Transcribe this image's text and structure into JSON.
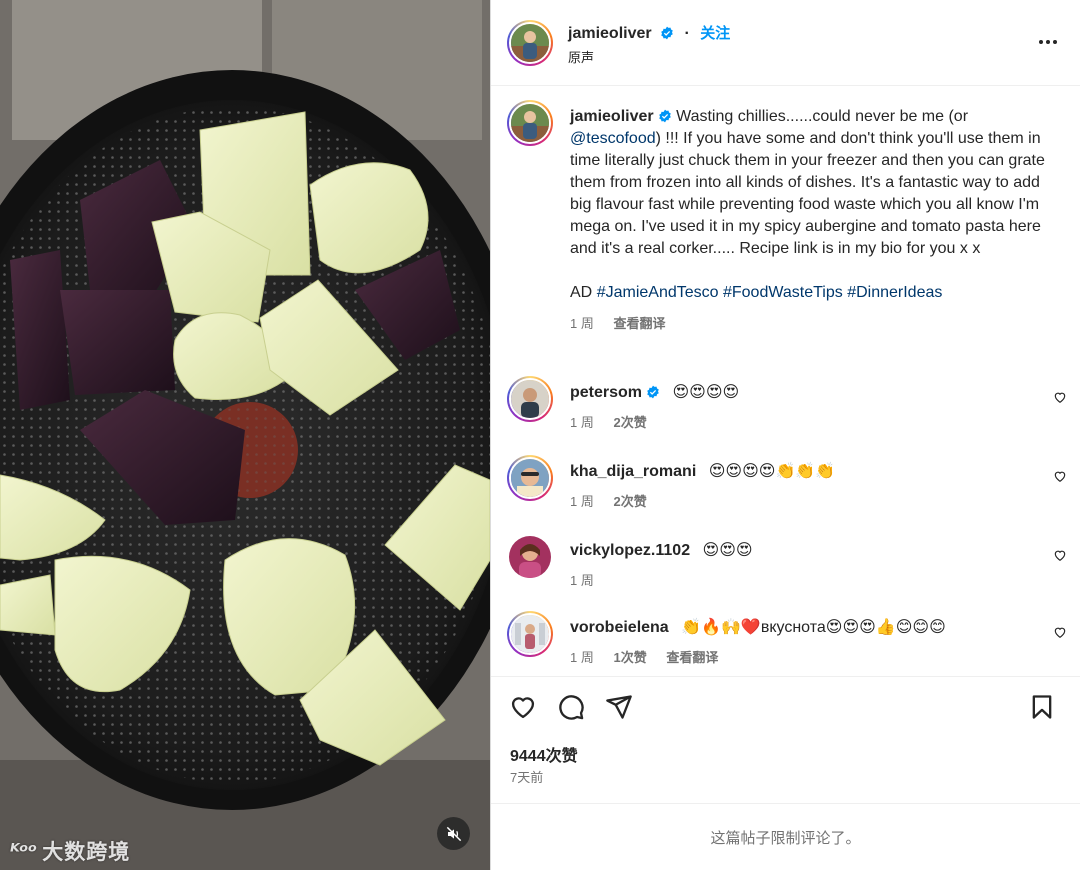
{
  "media": {
    "mute_icon": "volume-muted-icon",
    "watermark": {
      "mark": "ᴷᵒᵒ",
      "text": "大数跨境"
    }
  },
  "post_header": {
    "username": "jamieoliver",
    "follow_label": "关注",
    "audio_label": "原声",
    "more_icon": "more-horizontal-icon"
  },
  "caption": {
    "username": "jamieoliver",
    "text_before_mention": "Wasting chillies......could never be me (or ",
    "mention": "@tescofood",
    "text_after_mention": ") !!! If you have some and don't think you'll use them in time literally just chuck them in your freezer and then you can grate them from frozen into all kinds of dishes. It's a fantastic way to add big flavour fast while preventing food waste which you all know I'm mega on. I've used it in my spicy aubergine and tomato pasta here and it's a real corker..... Recipe link is in my bio for you x x",
    "ad_label": "AD",
    "hashtags": [
      "#JamieAndTesco",
      "#FoodWasteTips",
      "#DinnerIdeas"
    ],
    "time": "1 周",
    "translate_label": "查看翻译"
  },
  "comments": [
    {
      "username": "petersom",
      "verified": true,
      "text": "😍😍😍😍",
      "time": "1 周",
      "likes": "2次赞",
      "translate": ""
    },
    {
      "username": "kha_dija_romani",
      "verified": false,
      "text": "😍😍😍😍👏👏👏",
      "time": "1 周",
      "likes": "2次赞",
      "translate": ""
    },
    {
      "username": "vickylopez.1102",
      "verified": false,
      "text": "😍😍😍",
      "time": "1 周",
      "likes": "",
      "translate": ""
    },
    {
      "username": "vorobeielena",
      "verified": false,
      "text": "👏🔥🙌❤️вкуснота😍😍😍👍😊😊😊",
      "time": "1 周",
      "likes": "1次赞",
      "translate": "查看翻译"
    }
  ],
  "actions": {
    "like_icon": "heart-icon",
    "comment_icon": "comment-bubble-icon",
    "share_icon": "paper-plane-icon",
    "save_icon": "bookmark-icon",
    "likes_count": "9444次赞",
    "posted_ago": "7天前"
  },
  "comments_restricted": "这篇帖子限制评论了。",
  "colors": {
    "link": "#00376b",
    "follow": "#0095f6",
    "muted_text": "#737373",
    "verified": "#0095f6"
  }
}
